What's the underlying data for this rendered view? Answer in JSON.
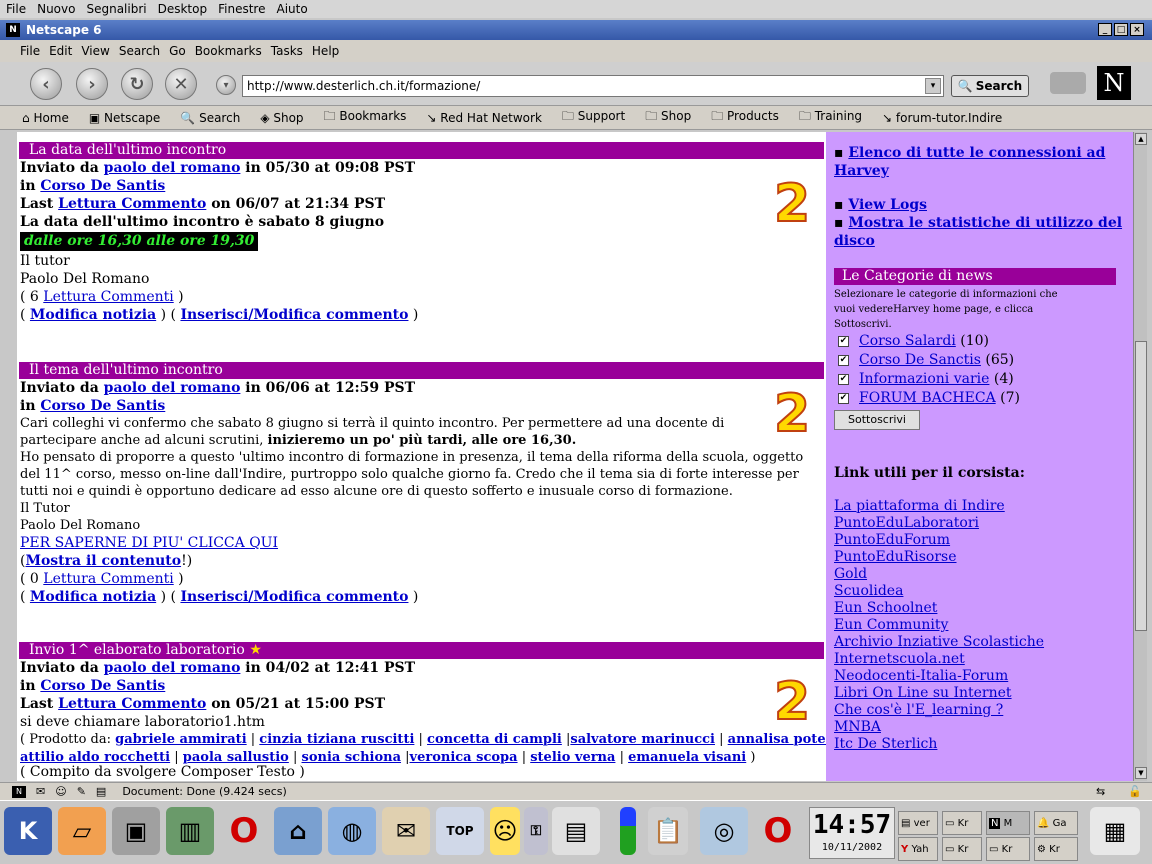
{
  "desktop_menu": [
    "File",
    "Nuovo",
    "Segnalibri",
    "Desktop",
    "Finestre",
    "Aiuto"
  ],
  "window": {
    "title": "Netscape 6"
  },
  "menubar": [
    "File",
    "Edit",
    "View",
    "Search",
    "Go",
    "Bookmarks",
    "Tasks",
    "Help"
  ],
  "toolbar": {
    "url": "http://www.desterlich.ch.it/formazione/",
    "search_label": "Search",
    "logo": "N"
  },
  "personal_bar": [
    "Home",
    "Netscape",
    "Search",
    "Shop",
    "Bookmarks",
    "Red Hat Network",
    "Support",
    "Shop",
    "Products",
    "Training",
    "forum-tutor.Indire"
  ],
  "posts": [
    {
      "title": "La data dell'ultimo incontro",
      "posted_prefix": "Inviato da",
      "author": "paolo del romano",
      "posted_on": "in 05/30 at 09:08 PST",
      "in_prefix": "in",
      "category": "Corso De Santis",
      "last_prefix": "Last",
      "last_link": "Lettura Commento",
      "last_on": "on 06/07 at 21:34 PST",
      "body1": "La data dell'ultimo incontro è sabato 8 giugno",
      "highlight": "dalle ore 16,30 alle ore 19,30",
      "body2": "Il tutor",
      "body3": "Paolo Del Romano",
      "comments_count": "( 6",
      "comments_link": "Lettura Commenti",
      "comments_close": ")",
      "edit_link": "Modifica notizia",
      "insert_link": "Inserisci/Modifica commento",
      "badge": "2"
    },
    {
      "title": "Il tema dell'ultimo incontro",
      "posted_prefix": "Inviato da",
      "author": "paolo del romano",
      "posted_on": "in 06/06 at 12:59 PST",
      "in_prefix": "in",
      "category": "Corso De Santis",
      "p1a": "Cari colleghi vi confermo che sabato 8 giugno si terrà il quinto incontro. Per permettere ad una docente di partecipare anche ad alcuni scrutini,",
      "p1b": "inizieremo un po' più tardi, alle ore 16,30.",
      "p2": "Ho pensato di proporre a questo 'ultimo incontro di formazione in presenza, il tema della riforma della scuola, oggetto del 11^ corso, messo on-line dall'Indire, purtroppo solo qualche giorno fa. Credo che il tema sia di forte interesse per tutti noi e quindi è opportuno dedicare ad esso alcune ore di questo sofferto e inusuale corso di formazione.",
      "sig1": "Il Tutor",
      "sig2": "Paolo Del Romano",
      "more_link": "PER SAPERNE DI PIU' CLICCA QUI",
      "show_link": "Mostra il contenuto",
      "comments_count": "( 0",
      "comments_link": "Lettura Commenti",
      "comments_close": ")",
      "edit_link": "Modifica notizia",
      "insert_link": "Inserisci/Modifica commento",
      "badge": "2"
    },
    {
      "title": "Invio 1^ elaborato laboratorio",
      "posted_prefix": "Inviato da",
      "author": "paolo del romano",
      "posted_on": "in 04/02 at 12:41 PST",
      "in_prefix": "in",
      "category": "Corso De Santis",
      "last_prefix": "Last",
      "last_link": "Lettura Commento",
      "last_on": "on 05/21 at 15:00 PST",
      "body1": "si deve chiamare laboratorio1.htm",
      "product_prefix": "( Prodotto da:",
      "people_row1": [
        "gabriele ammirati",
        "cinzia tiziana  ruscitti",
        "concetta di campli",
        "salvatore marinucci",
        "annalisa potenza"
      ],
      "people_row2": [
        "attilio aldo rocchetti",
        "paola sallustio",
        "sonia schiona",
        "veronica scopa",
        "stelio verna",
        "emanuela visani"
      ],
      "row2_close": ")",
      "cutoff": "( Compito da svolgere Composer  Testo  )",
      "badge": "2"
    }
  ],
  "sidebar": {
    "top_links": [
      "Elenco di tutte le connessioni ad Harvey",
      "View Logs",
      "Mostra le statistiche di utilizzo del disco"
    ],
    "categories_title": "Le Categorie di news",
    "categories_desc": "Selezionare le categorie di informazioni che vuoi vedereHarvey home page, e clicca Sottoscrivi.",
    "categories": [
      {
        "name": "Corso Salardi",
        "count": "(10)"
      },
      {
        "name": "Corso De Sanctis",
        "count": "(65)"
      },
      {
        "name": "Informazioni varie",
        "count": "(4)"
      },
      {
        "name": "FORUM BACHECA",
        "count": "(7)"
      }
    ],
    "subscribe_label": "Sottoscrivi",
    "links_title": "Link utili per il corsista:",
    "links": [
      "La piattaforma di Indire",
      "PuntoEduLaboratori",
      "PuntoEduForum",
      "PuntoEduRisorse",
      "Gold",
      "Scuolidea",
      "Eun Schoolnet",
      "Eun Community",
      "Archivio Inziative Scolastiche",
      "Internetscuola.net",
      "Neodocenti-Italia-Forum",
      "Libri On Line su Internet",
      "Che cos'è l'E_learning ?",
      "MNBA",
      "Itc De Sterlich"
    ]
  },
  "status": {
    "text": "Document: Done (9.424 secs)"
  },
  "taskbar": {
    "clock_time": "14:57",
    "clock_date": "10/11/2002",
    "tasks_top": [
      "ver",
      "Kr",
      "M",
      "Ga"
    ],
    "tasks_bottom": [
      "Yah",
      "Kr",
      "Kr",
      "Kr"
    ]
  }
}
